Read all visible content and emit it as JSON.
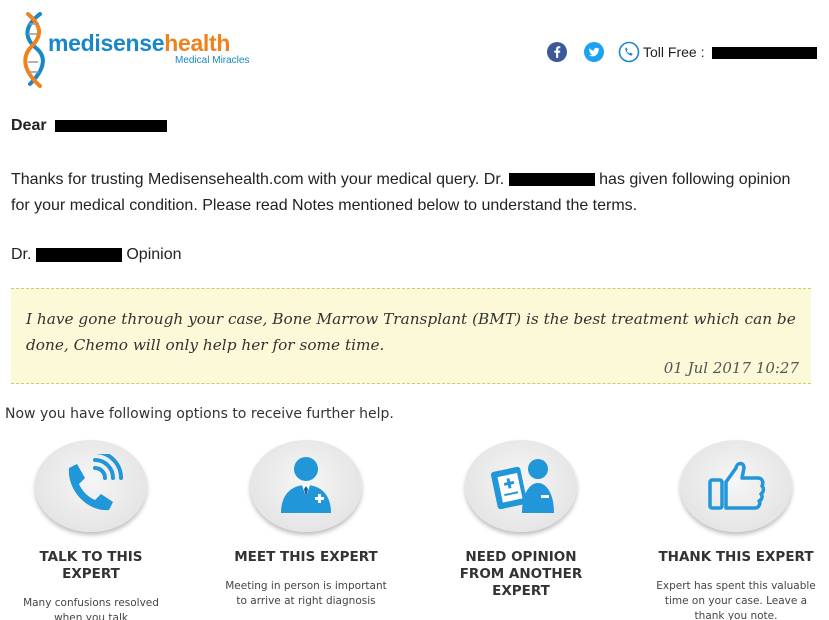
{
  "brand": {
    "name_part1": "medisense",
    "name_part2": "health",
    "tagline": "Medical Miracles"
  },
  "header": {
    "toll_free_label": "Toll Free :",
    "icons": [
      "facebook-icon",
      "twitter-icon",
      "phone-icon"
    ]
  },
  "letter": {
    "greeting": "Dear",
    "intro_line1_before": "Thanks for trusting Medisensehealth.com with your medical query. Dr.",
    "intro_line1_after": "has given following opinion",
    "intro_line2": "for your medical condition. Please read Notes mentioned below to understand the terms.",
    "opinion_prefix": "Dr.",
    "opinion_suffix": "Opinion",
    "quote": "I have gone through your case, Bone Marrow Transplant (BMT) is the best treatment which can be done, Chemo will only help her for some time.",
    "quote_date": "01 Jul 2017 10:27"
  },
  "options": {
    "intro": "Now you have following options to receive further help.",
    "items": [
      {
        "title": "TALK TO THIS EXPERT",
        "desc": "Many confusions resolved when you talk",
        "icon": "phone-call-icon"
      },
      {
        "title": "MEET THIS EXPERT",
        "desc": "Meeting in person is important to arrive at right diagnosis",
        "icon": "doctor-icon"
      },
      {
        "title": "NEED OPINION FROM ANOTHER EXPERT",
        "desc": "",
        "icon": "medical-report-icon"
      },
      {
        "title": "THANK THIS EXPERT",
        "desc": "Expert has spent this valuable time on your case. Leave a thank you note.",
        "icon": "thumbs-up-icon"
      }
    ]
  },
  "colors": {
    "brand_blue": "#1a87c9",
    "brand_orange": "#f0821e",
    "quote_bg": "#fcf9d8",
    "icon_blue": "#2196d8"
  }
}
